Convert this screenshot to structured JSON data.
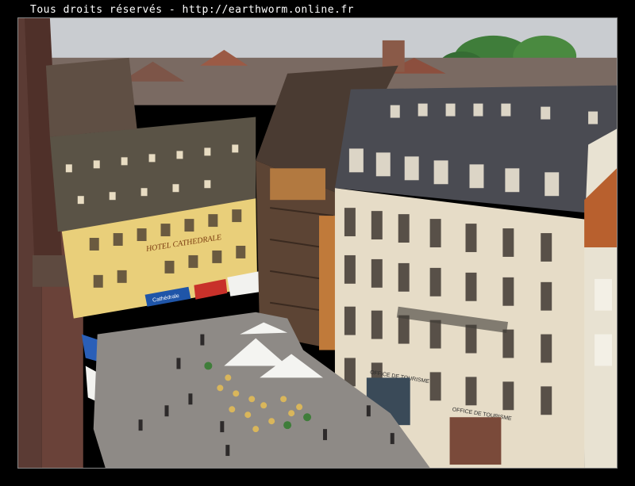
{
  "watermark": {
    "text": "Tous droits réservés - http://earthworm.online.fr"
  },
  "signs": {
    "hotel": "HOTEL CATHEDRALE",
    "cafe": "Cathédrale",
    "office_1": "OFFICE DE TOURISME",
    "office_2": "OFFICE DE TOURISME"
  },
  "colors": {
    "frame": "#000000",
    "sky": "#c9ccd0",
    "roof_dark": "#4a4b52",
    "facade_left": "#e9cf7a",
    "facade_right": "#e6dcc7",
    "timber": "#6b4a33",
    "square": "#8e8a86",
    "trees": "#3f7d3a"
  }
}
